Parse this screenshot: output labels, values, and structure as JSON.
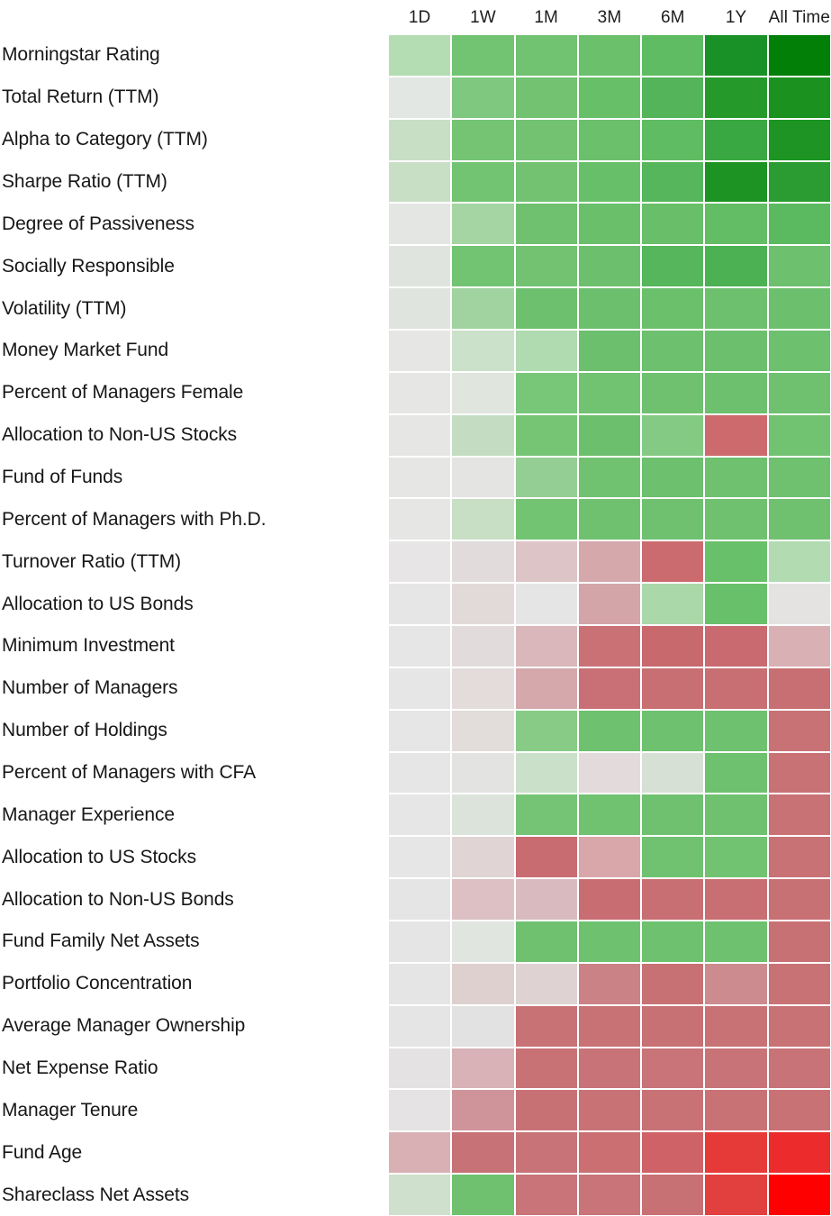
{
  "columns": [
    "1D",
    "1W",
    "1M",
    "3M",
    "6M",
    "1Y",
    "All Time"
  ],
  "rows": [
    "Morningstar Rating",
    "Total Return (TTM)",
    "Alpha to Category (TTM)",
    "Sharpe Ratio (TTM)",
    "Degree of Passiveness",
    "Socially Responsible",
    "Volatility (TTM)",
    "Money Market Fund",
    "Percent of Managers Female",
    "Allocation to Non-US Stocks",
    "Fund of Funds",
    "Percent of Managers with Ph.D.",
    "Turnover Ratio (TTM)",
    "Allocation to US Bonds",
    "Minimum Investment",
    "Number of Managers",
    "Number of Holdings",
    "Percent of Managers with CFA",
    "Manager Experience",
    "Allocation to US Stocks",
    "Allocation to Non-US Bonds",
    "Fund Family Net Assets",
    "Portfolio Concentration",
    "Average Manager Ownership",
    "Net Expense Ratio",
    "Manager Tenure",
    "Fund Age",
    "Shareclass Net Assets"
  ],
  "palette": {
    "neutral": "#e5e5e5",
    "strong_green": "#008000",
    "strong_red": "#ff0000"
  },
  "chart_data": {
    "type": "heatmap",
    "title": "",
    "xlabel": "",
    "ylabel": "",
    "grid": false,
    "legend": "none",
    "x_categories": [
      "1D",
      "1W",
      "1M",
      "3M",
      "6M",
      "1Y",
      "All Time"
    ],
    "y_categories": [
      "Morningstar Rating",
      "Total Return (TTM)",
      "Alpha to Category (TTM)",
      "Sharpe Ratio (TTM)",
      "Degree of Passiveness",
      "Socially Responsible",
      "Volatility (TTM)",
      "Money Market Fund",
      "Percent of Managers Female",
      "Allocation to Non-US Stocks",
      "Fund of Funds",
      "Percent of Managers with Ph.D.",
      "Turnover Ratio (TTM)",
      "Allocation to US Bonds",
      "Minimum Investment",
      "Number of Managers",
      "Number of Holdings",
      "Percent of Managers with CFA",
      "Manager Experience",
      "Allocation to US Stocks",
      "Allocation to Non-US Bonds",
      "Fund Family Net Assets",
      "Portfolio Concentration",
      "Average Manager Ownership",
      "Net Expense Ratio",
      "Manager Tenure",
      "Fund Age",
      "Shareclass Net Assets"
    ],
    "colorscale": "red-white-green (diverging); green = positive, red = negative, light grey = neutral/zero",
    "cell_colors": [
      [
        "#b5ddb4",
        "#72c472",
        "#71c271",
        "#6bc06c",
        "#5fbc62",
        "#1a9127",
        "#017f06"
      ],
      [
        "#e3e7e4",
        "#7fc880",
        "#72c272",
        "#67bf68",
        "#53b45a",
        "#259a2b",
        "#1b911f"
      ],
      [
        "#c8dfc6",
        "#74c474",
        "#72c272",
        "#6bc06c",
        "#60bc62",
        "#3aa842",
        "#1d9423"
      ],
      [
        "#c8dfc6",
        "#72c472",
        "#72c272",
        "#68bf69",
        "#55b65c",
        "#1c9323",
        "#2a9c31"
      ],
      [
        "#e4e6e3",
        "#a4d5a3",
        "#6fc170",
        "#6abf6b",
        "#68be69",
        "#62bd65",
        "#5bb95f"
      ],
      [
        "#dfe5de",
        "#72c473",
        "#72c272",
        "#6cc06d",
        "#55b65c",
        "#4bb153",
        "#6dc06e"
      ],
      [
        "#dfe5de",
        "#a0d3a0",
        "#6dc06e",
        "#6cc06d",
        "#6bc06c",
        "#6dc06e",
        "#6cc06d"
      ],
      [
        "#e6e6e5",
        "#cbe1c9",
        "#b0dab0",
        "#6cc06d",
        "#6dc06e",
        "#6cc06d",
        "#6dc06e"
      ],
      [
        "#e6e6e5",
        "#e0e5de",
        "#78c678",
        "#71c271",
        "#6fc170",
        "#6dc06e",
        "#6fc170"
      ],
      [
        "#e6e6e5",
        "#c4ddc2",
        "#75c575",
        "#6cc06d",
        "#84ca84",
        "#cd6a6e",
        "#71c271"
      ],
      [
        "#e6e6e5",
        "#e4e4e3",
        "#95ce94",
        "#70c271",
        "#6dc06e",
        "#6fc170",
        "#6fc170"
      ],
      [
        "#e6e6e5",
        "#c8dfc6",
        "#72c472",
        "#6fc170",
        "#6fc170",
        "#6fc170",
        "#6fc170"
      ],
      [
        "#e7e5e6",
        "#e1dbdc",
        "#ddc4c6",
        "#d5a8ab",
        "#cc6b6f",
        "#69c06a",
        "#b2dbb1"
      ],
      [
        "#e6e6e6",
        "#e2dad9",
        "#e6e5e5",
        "#d3a5a8",
        "#aad8a8",
        "#69c06a",
        "#e5e2e2"
      ],
      [
        "#e6e6e6",
        "#e2dbdb",
        "#d9b7bb",
        "#c97175",
        "#c8696e",
        "#c86a6f",
        "#d9b0b4"
      ],
      [
        "#e6e6e6",
        "#e3dcdb",
        "#d5a8ac",
        "#c87075",
        "#c86f73",
        "#c86f73",
        "#c86f73"
      ],
      [
        "#e6e6e6",
        "#e2dcdb",
        "#87cb87",
        "#6ec16e",
        "#6ec16f",
        "#6ec16f",
        "#c87276"
      ],
      [
        "#e6e6e6",
        "#e3e4e2",
        "#cbe0c8",
        "#e3dadb",
        "#d7e0d5",
        "#6ec16f",
        "#c87276"
      ],
      [
        "#e6e6e6",
        "#dbe3da",
        "#75c475",
        "#70c271",
        "#6fc170",
        "#6fc170",
        "#c87276"
      ],
      [
        "#e6e6e6",
        "#e0d4d4",
        "#c86c71",
        "#d9a6aa",
        "#70c271",
        "#71c271",
        "#c87276"
      ],
      [
        "#e5e5e5",
        "#dcc0c3",
        "#d9bbbf",
        "#c86e72",
        "#c86f73",
        "#c86f73",
        "#c87175"
      ],
      [
        "#e5e5e5",
        "#e0e5df",
        "#6fc170",
        "#6ec16f",
        "#6ec16f",
        "#6ec16f",
        "#c87175"
      ],
      [
        "#e5e5e5",
        "#ded0ce",
        "#ded2d3",
        "#cb8286",
        "#c87175",
        "#cc8b8e",
        "#c87276"
      ],
      [
        "#e5e5e5",
        "#e3e2e2",
        "#c87276",
        "#c87276",
        "#c87175",
        "#c87276",
        "#c87276"
      ],
      [
        "#e4e2e2",
        "#d8b2b6",
        "#c87276",
        "#c87377",
        "#c87478",
        "#c87377",
        "#c87377"
      ],
      [
        "#e5e3e3",
        "#cf9499",
        "#c87175",
        "#c87276",
        "#c87276",
        "#c87276",
        "#c87276"
      ],
      [
        "#d9b1b5",
        "#c77277",
        "#c87377",
        "#cb6f73",
        "#cf6266",
        "#e63a39",
        "#ec2c2c"
      ],
      [
        "#cfe0cc",
        "#6fc170",
        "#c87478",
        "#c87478",
        "#c87175",
        "#e2403f",
        "#ff0000"
      ]
    ]
  }
}
